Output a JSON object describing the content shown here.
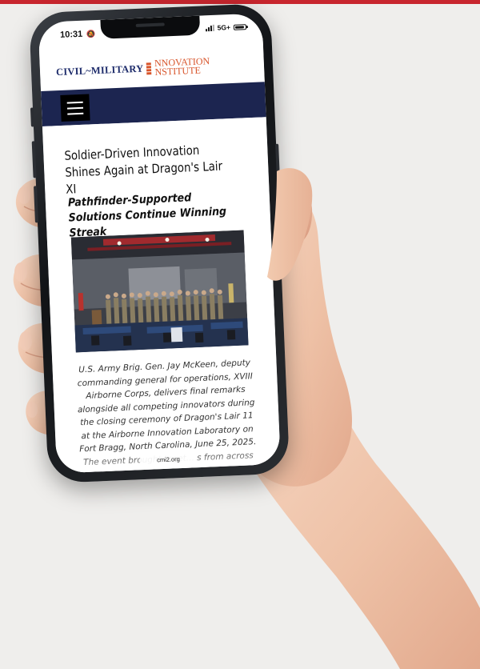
{
  "status_bar": {
    "time": "10:31",
    "network": "5G+"
  },
  "site": {
    "logo_left": "CIVIL~MILITARY",
    "logo_right_line1": "NNOVATION",
    "logo_right_line2": "NSTITUTE",
    "brand_colors": {
      "navy": "#1e2c6b",
      "orange": "#d8542a",
      "nav_bar": "#1c2550"
    }
  },
  "nav": {
    "menu_icon": "hamburger-menu-icon"
  },
  "article": {
    "headline": "Soldier-Driven Innovation Shines Again at Dragon's Lair XI",
    "subheadline": "Pathfinder-Supported Solutions Continue Winning Streak",
    "caption": "U.S. Army Brig. Gen. Jay McKeen, deputy commanding general for operations, XVIII Airborne Corps, delivers final remarks alongside all competing innovators during the closing ceremony of Dragon's Lair 11 at the Airborne Innovation Laboratory on Fort Bragg, North Carolina, June 25, 2025. The event brought toget... s from across"
  },
  "browser": {
    "url": "cmi2.org"
  },
  "accent_band_color": "#c8262e"
}
